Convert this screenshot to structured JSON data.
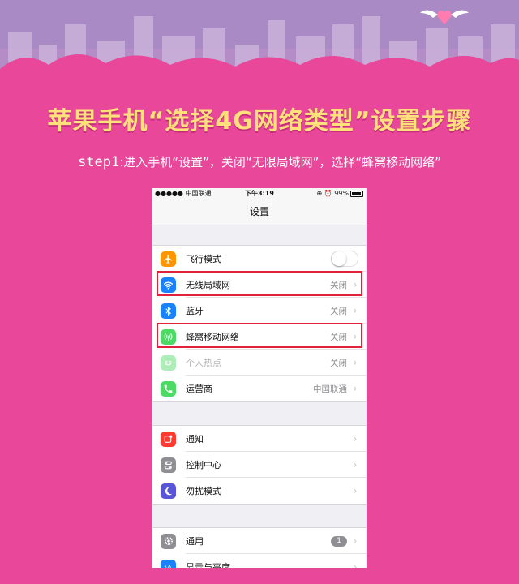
{
  "title": "苹果手机“选择4G网络类型”设置步骤",
  "step": {
    "label": "step1",
    "text": ":进入手机“设置”，关闭“无限局域网”，选择“蜂窝移动网络”"
  },
  "phone": {
    "status_bar": {
      "carrier": "●●●●● 中国联通",
      "time": "下午3:19",
      "battery": "99%"
    },
    "nav_title": "设置",
    "groups": [
      {
        "rows": [
          {
            "label": "飞行模式",
            "icon": "airplane-icon",
            "color": "#ff9500",
            "accessory": "toggle",
            "value": ""
          },
          {
            "label": "无线局域网",
            "icon": "wifi-icon",
            "color": "#1a82fb",
            "value": "关闭"
          },
          {
            "label": "蓝牙",
            "icon": "bluetooth-icon",
            "color": "#1a82fb",
            "value": "关闭"
          },
          {
            "label": "蜂窝移动网络",
            "icon": "cellular-icon",
            "color": "#4cd964",
            "value": "关闭"
          },
          {
            "label": "个人热点",
            "icon": "hotspot-icon",
            "color": "#4cd964",
            "value": "关闭",
            "disabled": true
          },
          {
            "label": "运营商",
            "icon": "phone-icon",
            "color": "#4cd964",
            "value": "中国联通"
          }
        ]
      },
      {
        "rows": [
          {
            "label": "通知",
            "icon": "notifications-icon",
            "color": "#ff3b30",
            "value": ""
          },
          {
            "label": "控制中心",
            "icon": "control-center-icon",
            "color": "#8e8e93",
            "value": ""
          },
          {
            "label": "勿扰模式",
            "icon": "moon-icon",
            "color": "#5856d6",
            "value": ""
          }
        ]
      },
      {
        "rows": [
          {
            "label": "通用",
            "icon": "gear-icon",
            "color": "#8e8e93",
            "badge": "1",
            "value": ""
          },
          {
            "label": "显示与亮度",
            "icon": "display-icon",
            "color": "#1a82fb",
            "value": ""
          }
        ]
      }
    ]
  },
  "colors": {
    "background": "#e8479a",
    "title": "#ffe07a",
    "highlight": "#e0223a"
  }
}
